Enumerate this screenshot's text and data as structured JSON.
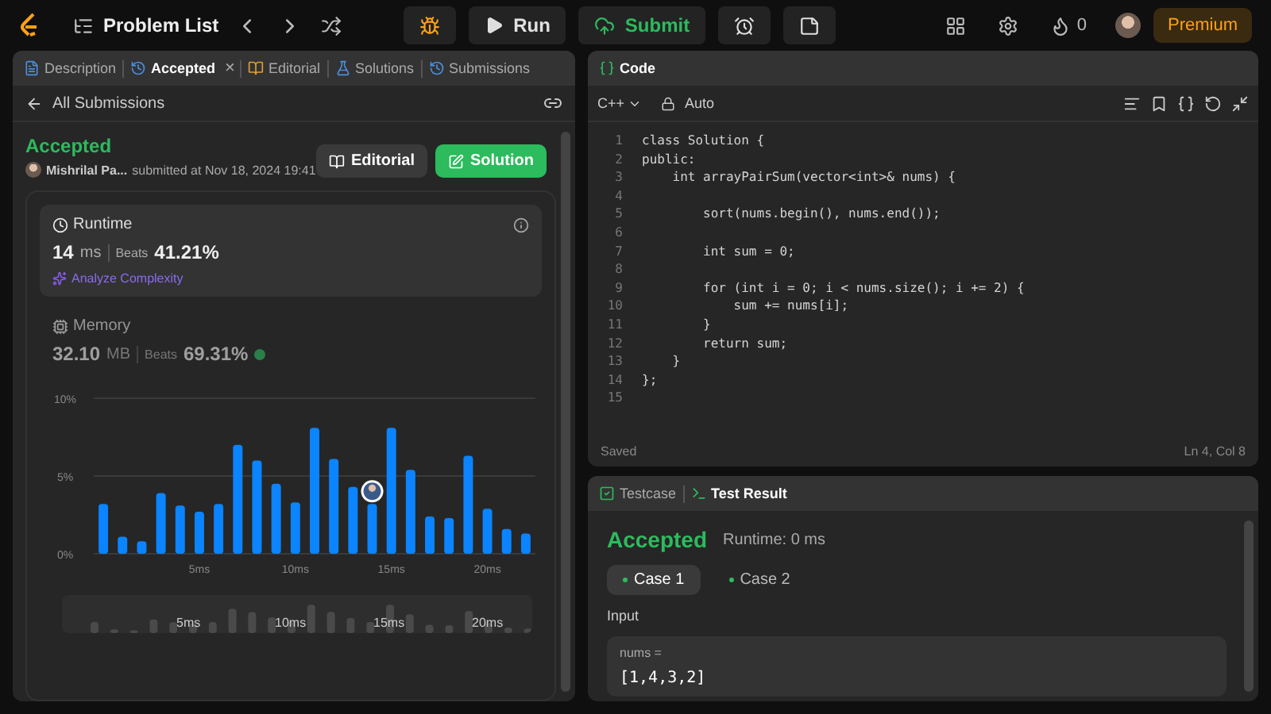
{
  "topbar": {
    "title": "Problem List",
    "run": "Run",
    "submit": "Submit",
    "streak": "0",
    "premium": "Premium"
  },
  "left": {
    "tabs": [
      {
        "label": "Description",
        "selected": false,
        "closable": false
      },
      {
        "label": "Accepted",
        "selected": true,
        "closable": true
      },
      {
        "label": "Editorial",
        "selected": false,
        "closable": false
      },
      {
        "label": "Solutions",
        "selected": false,
        "closable": false
      },
      {
        "label": "Submissions",
        "selected": false,
        "closable": false
      }
    ],
    "close": "×",
    "back": "All Submissions",
    "status": "Accepted",
    "author": "Mishrilal Pa...",
    "submitted": "submitted at Nov 18, 2024 19:41",
    "buttons": [
      {
        "label": "Editorial",
        "kind": "secondary"
      },
      {
        "label": "Solution",
        "kind": "primary"
      }
    ],
    "metrics": [
      {
        "label": "Runtime",
        "value": "14",
        "unit": "ms",
        "beats_label": "Beats",
        "beats": "41.21%",
        "selected": true,
        "action": "Analyze Complexity"
      },
      {
        "label": "Memory",
        "value": "32.10",
        "unit": "MB",
        "beats_label": "Beats",
        "beats": "69.31%",
        "selected": false
      }
    ],
    "chart_data": {
      "type": "bar",
      "x": [
        0,
        1,
        2,
        3,
        4,
        5,
        6,
        7,
        8,
        9,
        10,
        11,
        12,
        13,
        14,
        15,
        16,
        17,
        18,
        19,
        20,
        21,
        22
      ],
      "values": [
        3.2,
        1.1,
        0.8,
        3.9,
        3.1,
        2.7,
        3.2,
        7.0,
        6.0,
        4.5,
        3.3,
        8.1,
        6.1,
        4.3,
        3.2,
        8.1,
        5.4,
        2.4,
        2.3,
        6.3,
        2.9,
        1.6,
        1.3
      ],
      "xlim": [
        -0.5,
        22.5
      ],
      "ylim": [
        0,
        10
      ],
      "yticks": [
        {
          "value": 0,
          "label": "0%"
        },
        {
          "value": 5,
          "label": "5%"
        },
        {
          "value": 10,
          "label": "10%"
        }
      ],
      "xticks": [
        {
          "value": 5,
          "label": "5ms"
        },
        {
          "value": 10,
          "label": "10ms"
        },
        {
          "value": 15,
          "label": "15ms"
        },
        {
          "value": 20,
          "label": "20ms"
        }
      ]
    },
    "navigator_labels": [
      "5ms",
      "10ms",
      "15ms",
      "20ms"
    ]
  },
  "code": {
    "title": "Code",
    "language": "C++",
    "mode": "Auto",
    "saved": "Saved",
    "position": "Ln 4, Col 8",
    "lines": [
      {
        "number": "1",
        "text": "class Solution {"
      },
      {
        "number": "2",
        "text": "public:"
      },
      {
        "number": "3",
        "text": "    int arrayPairSum(vector<int>& nums) {"
      },
      {
        "number": "4"
      },
      {
        "number": "5",
        "text": "        sort(nums.begin(), nums.end());"
      },
      {
        "number": "6"
      },
      {
        "number": "7",
        "text": "        int sum = 0;"
      },
      {
        "number": "8"
      },
      {
        "number": "9",
        "text": "        for (int i = 0; i < nums.size(); i += 2) {"
      },
      {
        "number": "10",
        "text": "            sum += nums[i];"
      },
      {
        "number": "11",
        "text": "        }"
      },
      {
        "number": "12",
        "text": "        return sum;"
      },
      {
        "number": "13",
        "text": "    }"
      },
      {
        "number": "14",
        "text": "};"
      },
      {
        "number": "15"
      }
    ]
  },
  "tests": {
    "tabs": [
      {
        "label": "Testcase",
        "selected": false
      },
      {
        "label": "Test Result",
        "selected": true
      }
    ],
    "status": "Accepted",
    "runtime": "Runtime: 0 ms",
    "cases": [
      {
        "label": "Case 1",
        "selected": true
      },
      {
        "label": "Case 2",
        "selected": false
      }
    ],
    "input_label": "Input",
    "var_label": "nums =",
    "value": "[1,4,3,2]"
  }
}
